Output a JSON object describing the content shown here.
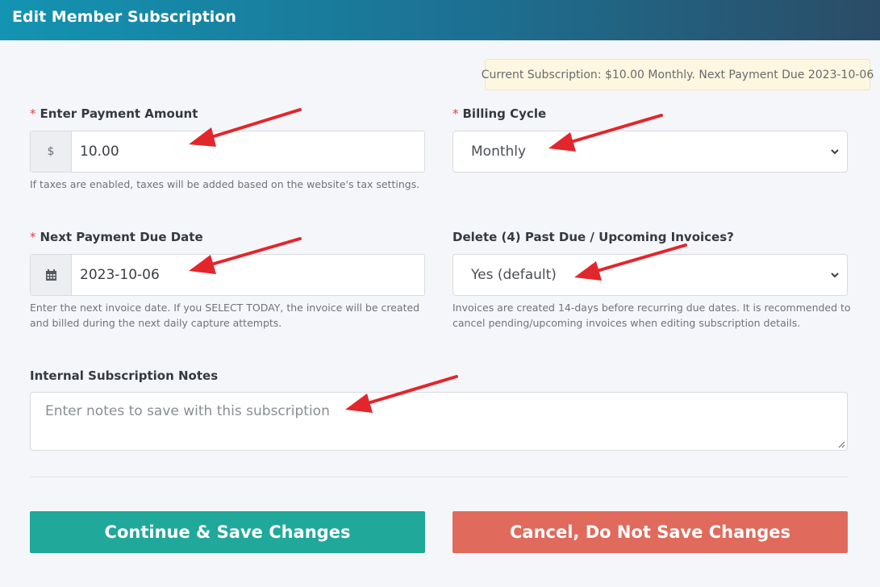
{
  "header": {
    "title": "Edit Member Subscription"
  },
  "notice": {
    "text": "Current Subscription: $10.00 Monthly. Next Payment Due 2023-10-06"
  },
  "payment_amount": {
    "required_mark": "*",
    "label": "Enter Payment Amount",
    "addon": "$",
    "value": "10.00",
    "help": "If taxes are enabled, taxes will be added based on the website's tax settings."
  },
  "billing_cycle": {
    "required_mark": "*",
    "label": "Billing Cycle",
    "selected": "Monthly"
  },
  "next_due_date": {
    "required_mark": "*",
    "label": "Next Payment Due Date",
    "addon_icon": "calendar-icon",
    "value": "2023-10-06",
    "help_line1": "Enter the next invoice date. If you SELECT TODAY, the invoice will be created",
    "help_line2": "and billed during the next daily capture attempts."
  },
  "delete_invoices": {
    "label": "Delete (4) Past Due / Upcoming Invoices?",
    "selected": "Yes (default)",
    "help_line1": "Invoices are created 14-days before recurring due dates. It is recommended to",
    "help_line2": "cancel pending/upcoming invoices when editing subscription details."
  },
  "notes": {
    "label": "Internal Subscription Notes",
    "placeholder": "Enter notes to save with this subscription"
  },
  "buttons": {
    "save": "Continue & Save Changes",
    "cancel": "Cancel, Do Not Save Changes"
  },
  "colors": {
    "header_start": "#1394b2",
    "header_end": "#2b4c66",
    "save_button": "#20a89a",
    "cancel_button": "#e06a5c",
    "required_mark": "#e0463d",
    "annotation_arrow": "#e3262b"
  }
}
